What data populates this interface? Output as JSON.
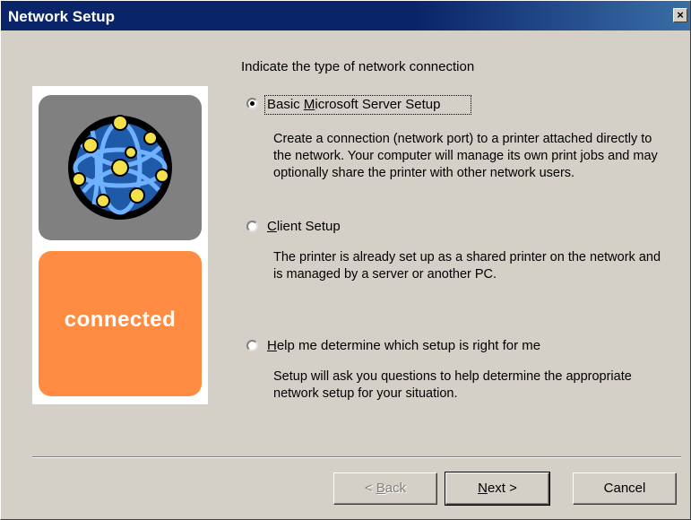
{
  "window": {
    "title": "Network Setup",
    "close_glyph": "×"
  },
  "art": {
    "globe_icon": "network-globe-icon",
    "brand_text": "connected",
    "brand_color": "#ff8c42"
  },
  "prompt": "Indicate the type of network connection",
  "options": [
    {
      "label_pre": "Basic ",
      "label_underline": "M",
      "label_post": "icrosoft Server Setup",
      "selected": true,
      "description": "Create a connection (network port) to a printer attached directly to the network.  Your computer will manage its own print jobs and may optionally share the printer with other network users."
    },
    {
      "label_pre": "",
      "label_underline": "C",
      "label_post": "lient Setup",
      "selected": false,
      "description": "The printer is already set up as a shared printer on the network and is managed by a server or another PC."
    },
    {
      "label_pre": "",
      "label_underline": "H",
      "label_post": "elp me determine which setup is right for me",
      "selected": false,
      "description": "Setup will ask you questions to help determine the appropriate network setup for your situation."
    }
  ],
  "buttons": {
    "back_pre": "< ",
    "back_u": "B",
    "back_post": "ack",
    "next_u": "N",
    "next_post": "ext >",
    "cancel": "Cancel"
  }
}
